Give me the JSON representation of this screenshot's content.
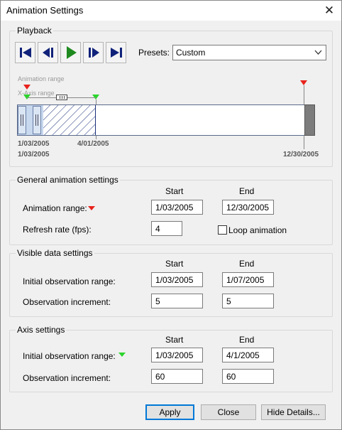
{
  "window": {
    "title": "Animation Settings"
  },
  "playback": {
    "title": "Playback",
    "presets_label": "Presets:",
    "presets_value": "Custom",
    "timeline": {
      "animation_range_label": "Animation range",
      "xaxis_range_label": "X-Axis range",
      "date_start_top": "1/03/2005",
      "date_mid_top": "4/01/2005",
      "date_start_bottom": "1/03/2005",
      "date_end": "12/30/2005"
    }
  },
  "general": {
    "title": "General animation settings",
    "start_header": "Start",
    "end_header": "End",
    "animation_range_label": "Animation range:",
    "animation_range_start": "1/03/2005",
    "animation_range_end": "12/30/2005",
    "refresh_rate_label": "Refresh rate (fps):",
    "refresh_rate_value": "4",
    "loop_label": "Loop animation"
  },
  "visible": {
    "title": "Visible data settings",
    "start_header": "Start",
    "end_header": "End",
    "initial_obs_label": "Initial observation range:",
    "initial_obs_start": "1/03/2005",
    "initial_obs_end": "1/07/2005",
    "obs_increment_label": "Observation increment:",
    "obs_increment_start": "5",
    "obs_increment_end": "5"
  },
  "axis": {
    "title": "Axis settings",
    "start_header": "Start",
    "end_header": "End",
    "initial_obs_label": "Initial observation range:",
    "initial_obs_start": "1/03/2005",
    "initial_obs_end": "4/1/2005",
    "obs_increment_label": "Observation increment:",
    "obs_increment_start": "60",
    "obs_increment_end": "60"
  },
  "footer": {
    "apply_label": "Apply",
    "close_label": "Close",
    "hide_details_label": "Hide Details..."
  },
  "colors": {
    "red_marker": "#e8231c",
    "green_marker": "#2bd42b",
    "accent": "#0078d7",
    "play_green": "#1f8a1f"
  },
  "icons": [
    "first-frame-icon",
    "step-back-icon",
    "play-icon",
    "step-forward-icon",
    "last-frame-icon",
    "chevron-down-icon",
    "close-icon"
  ]
}
